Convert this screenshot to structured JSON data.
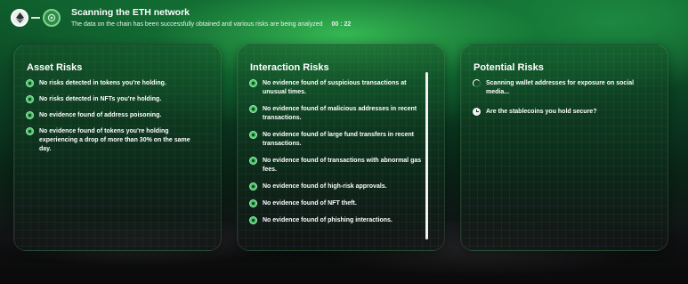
{
  "header": {
    "title": "Scanning the ETH network",
    "subtitle": "The data on the chain has been successfully obtained and various risks are being analyzed",
    "timer": "00 : 22",
    "steps": [
      {
        "icon": "ethereum-icon",
        "state": "done"
      },
      {
        "icon": "scan-icon",
        "state": "active"
      }
    ]
  },
  "cards": [
    {
      "title": "Asset Risks",
      "items": [
        {
          "status": "ok",
          "text": "No risks detected in tokens you're holding."
        },
        {
          "status": "ok",
          "text": "No risks detected in NFTs you're holding."
        },
        {
          "status": "ok",
          "text": "No evidence found of address poisoning."
        },
        {
          "status": "ok",
          "text": "No evidence found of tokens you're holding experiencing a drop of more than 30% on the same day."
        }
      ]
    },
    {
      "title": "Interaction Risks",
      "items": [
        {
          "status": "ok",
          "text": "No evidence found of suspicious transactions at unusual times."
        },
        {
          "status": "ok",
          "text": "No evidence found of malicious addresses in recent transactions."
        },
        {
          "status": "ok",
          "text": "No evidence found of large fund transfers in recent transactions."
        },
        {
          "status": "ok",
          "text": "No evidence found of transactions with abnormal gas fees."
        },
        {
          "status": "ok",
          "text": "No evidence found of high-risk approvals."
        },
        {
          "status": "ok",
          "text": "No evidence found of NFT theft."
        },
        {
          "status": "ok",
          "text": "No evidence found of phishing interactions."
        }
      ]
    },
    {
      "title": "Potential Risks",
      "items": [
        {
          "status": "scanning",
          "text": "Scanning wallet addresses for exposure on social media..."
        },
        {
          "status": "pending",
          "text": "Are the stablecoins you hold secure?"
        }
      ]
    }
  ],
  "colors": {
    "accent": "#3fbf62",
    "background": "#0b3f22"
  }
}
